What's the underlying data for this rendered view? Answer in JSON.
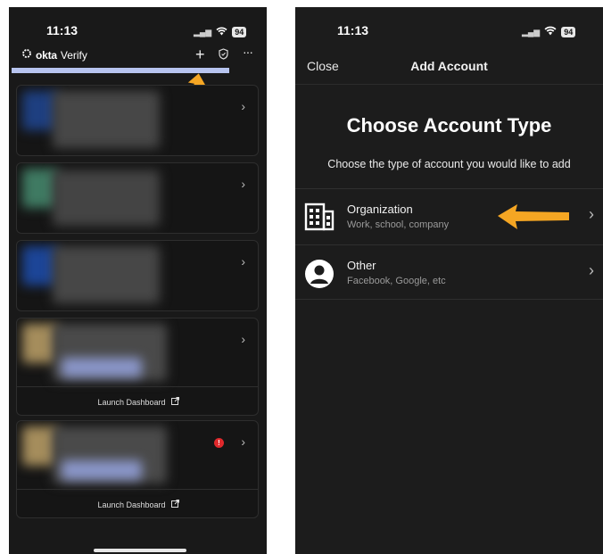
{
  "left_phone": {
    "status": {
      "time": "11:13",
      "battery": "94"
    },
    "header": {
      "brand_bold": "okta",
      "brand_rest": "Verify"
    },
    "cards": [
      {
        "launch_label": "",
        "has_alert": false
      },
      {
        "launch_label": "",
        "has_alert": false
      },
      {
        "launch_label": "",
        "has_alert": false
      },
      {
        "launch_label": "Launch Dashboard",
        "has_alert": false
      },
      {
        "launch_label": "Launch Dashboard",
        "has_alert": true,
        "alert_glyph": "!"
      }
    ],
    "icons": [
      "okta-logo-icon",
      "plus-icon",
      "shield-icon",
      "more-icon",
      "chevron-right-icon",
      "external-link-icon",
      "arrow-annotation-icon"
    ]
  },
  "right_phone": {
    "status": {
      "time": "11:13",
      "battery": "94"
    },
    "nav": {
      "close_label": "Close",
      "title": "Add Account"
    },
    "heading": "Choose Account Type",
    "subheading": "Choose the type of account you would like to add",
    "options": [
      {
        "label": "Organization",
        "description": "Work, school, company",
        "icon": "building-icon"
      },
      {
        "label": "Other",
        "description": "Facebook, Google, etc",
        "icon": "person-icon"
      }
    ]
  },
  "colors": {
    "background": "#1b1b1b",
    "annotation_arrow": "#f5a623",
    "progress": "#b7c4ef",
    "alert": "#e0292c"
  }
}
